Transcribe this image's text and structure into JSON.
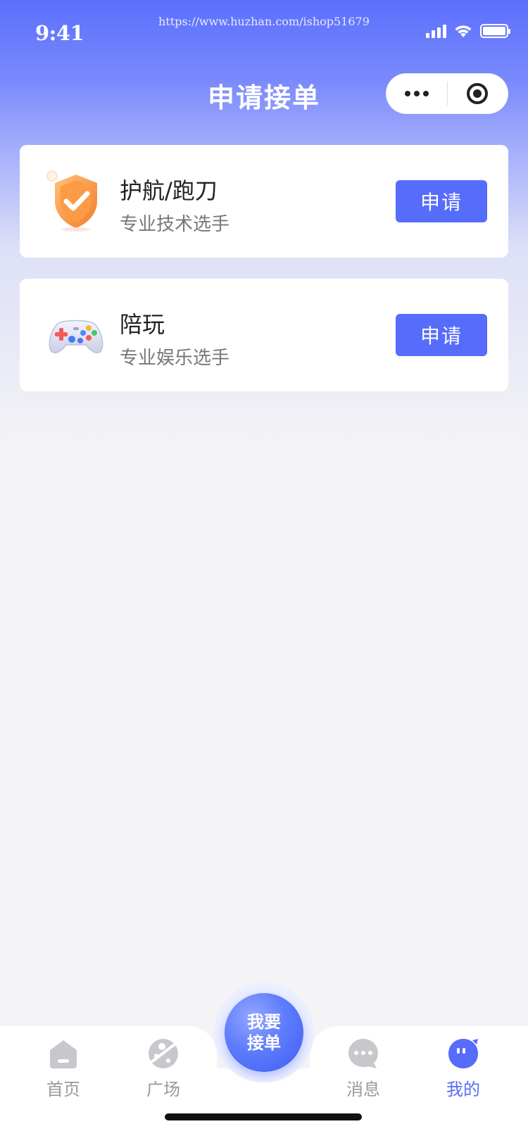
{
  "status_bar": {
    "time": "9:41",
    "watermark": "https://www.huzhan.com/ishop51679",
    "icons": [
      "signal-icon",
      "wifi-icon",
      "battery-icon"
    ]
  },
  "nav": {
    "title": "申请接单",
    "capsule": {
      "more_icon": "more-dots-icon",
      "close_icon": "target-close-icon"
    }
  },
  "cards": [
    {
      "icon": "shield-check-icon",
      "title": "护航/跑刀",
      "subtitle": "专业技术选手",
      "button": "申请"
    },
    {
      "icon": "gamepad-icon",
      "title": "陪玩",
      "subtitle": "专业娱乐选手",
      "button": "申请"
    }
  ],
  "tab_bar": {
    "items": [
      {
        "label": "首页",
        "icon": "home-icon",
        "active": false
      },
      {
        "label": "广场",
        "icon": "planet-icon",
        "active": false
      },
      {
        "label": "消息",
        "icon": "chat-bubble-icon",
        "active": false
      },
      {
        "label": "我的",
        "icon": "profile-face-icon",
        "active": true
      }
    ],
    "center_button": {
      "line1": "我要",
      "line2": "接单"
    }
  },
  "colors": {
    "accent": "#566cfb",
    "header_gradient_top": "#5b6ffd",
    "background": "#f4f4f6",
    "tab_inactive": "#9a9a9a"
  }
}
